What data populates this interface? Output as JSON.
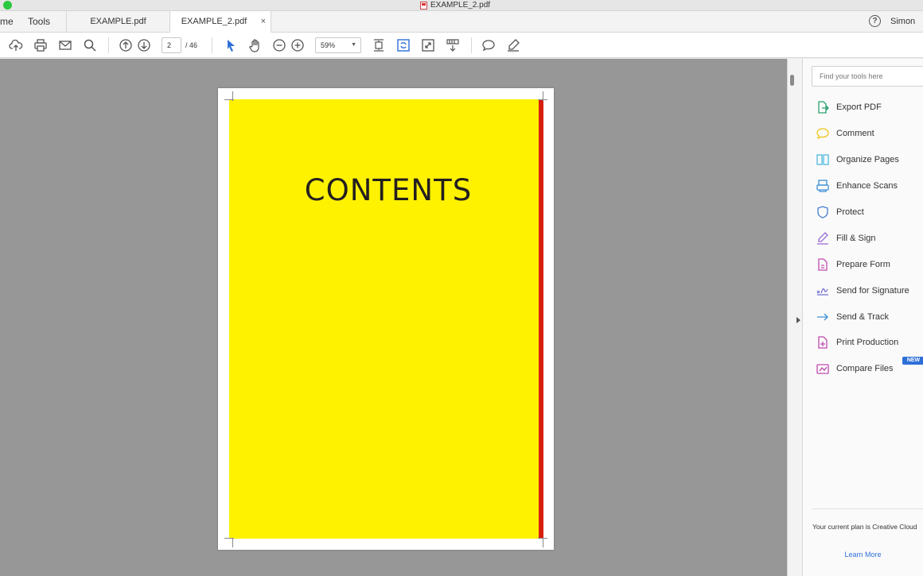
{
  "window": {
    "title": "EXAMPLE_2.pdf"
  },
  "tabbar": {
    "home_label": "me",
    "tools_label": "Tools",
    "tabs": [
      {
        "label": "EXAMPLE.pdf",
        "active": false
      },
      {
        "label": "EXAMPLE_2.pdf",
        "active": true
      }
    ],
    "close_glyph": "×",
    "help_glyph": "?",
    "user": "Simon"
  },
  "toolbar": {
    "current_page": "2",
    "total_pages": "/ 46",
    "zoom": "59%",
    "icons": [
      "upload-icon",
      "print-icon",
      "email-icon",
      "search-icon",
      "page-up-icon",
      "page-down-icon",
      "select-arrow-icon",
      "hand-icon",
      "zoom-out-icon",
      "zoom-in-icon",
      "fit-page-icon",
      "rotate-icon",
      "fullscreen-icon",
      "scroll-mode-icon",
      "comment-icon",
      "highlight-pen-icon"
    ]
  },
  "document": {
    "page_heading": "CONTENTS",
    "page_color": "#fff200",
    "accent_color": "#d61f0f"
  },
  "tools_panel": {
    "search_placeholder": "Find your tools here",
    "tools": [
      {
        "label": "Export PDF",
        "icon": "export-pdf-icon",
        "color": "#2aa06d"
      },
      {
        "label": "Comment",
        "icon": "comment-icon",
        "color": "#f0c419"
      },
      {
        "label": "Organize Pages",
        "icon": "organize-pages-icon",
        "color": "#4fb6e0"
      },
      {
        "label": "Enhance Scans",
        "icon": "enhance-scans-icon",
        "color": "#3a8fd6"
      },
      {
        "label": "Protect",
        "icon": "protect-shield-icon",
        "color": "#4a7fd0"
      },
      {
        "label": "Fill & Sign",
        "icon": "fill-sign-icon",
        "color": "#9a6dd8"
      },
      {
        "label": "Prepare Form",
        "icon": "prepare-form-icon",
        "color": "#c04ab0"
      },
      {
        "label": "Send for Signature",
        "icon": "send-signature-icon",
        "color": "#6a6ad0"
      },
      {
        "label": "Send & Track",
        "icon": "send-track-icon",
        "color": "#3a8fd6"
      },
      {
        "label": "Print Production",
        "icon": "print-production-icon",
        "color": "#c04ab0"
      },
      {
        "label": "Compare Files",
        "icon": "compare-files-icon",
        "color": "#c04ab0"
      }
    ],
    "new_badge": "NEW",
    "plan_text": "Your current plan is Creative Cloud",
    "learn_more": "Learn More"
  }
}
